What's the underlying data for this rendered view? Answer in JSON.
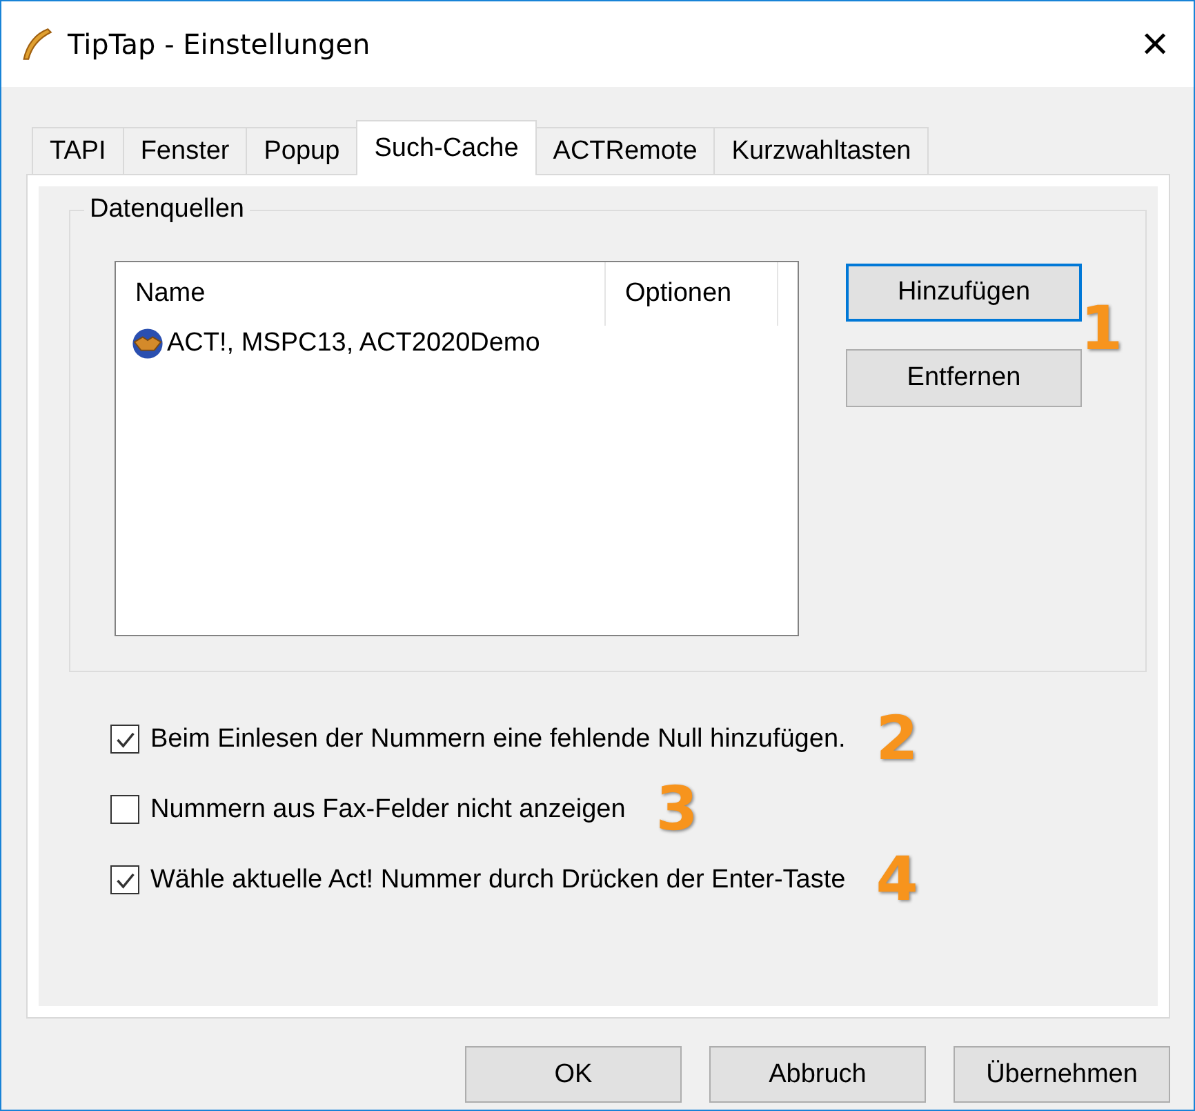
{
  "window": {
    "title": "TipTap - Einstellungen",
    "close": "×"
  },
  "tabs": [
    {
      "label": "TAPI",
      "selected": false
    },
    {
      "label": "Fenster",
      "selected": false
    },
    {
      "label": "Popup",
      "selected": false
    },
    {
      "label": "Such-Cache",
      "selected": true
    },
    {
      "label": "ACTRemote",
      "selected": false
    },
    {
      "label": "Kurzwahltasten",
      "selected": false
    }
  ],
  "group": {
    "title": "Datenquellen",
    "list": {
      "columns": [
        "Name",
        "Optionen"
      ],
      "rows": [
        {
          "name": "ACT!, MSPC13, ACT2020Demo",
          "selected": false
        }
      ]
    },
    "buttons": [
      {
        "label": "Hinzufügen",
        "focused": true
      },
      {
        "label": "Entfernen",
        "focused": false
      }
    ],
    "callout": "1"
  },
  "options": [
    {
      "label": "Beim Einlesen der Nummern eine fehlende Null hinzufügen.",
      "checked": true,
      "callout": "2"
    },
    {
      "label": "Nummern aus Fax-Felder nicht anzeigen",
      "checked": false,
      "callout": "3"
    },
    {
      "label": "Wähle aktuelle Act! Nummer durch Drücken der Enter-Taste",
      "checked": true,
      "callout": "4"
    }
  ],
  "buttons": [
    "OK",
    "Abbruch",
    "Übernehmen"
  ]
}
